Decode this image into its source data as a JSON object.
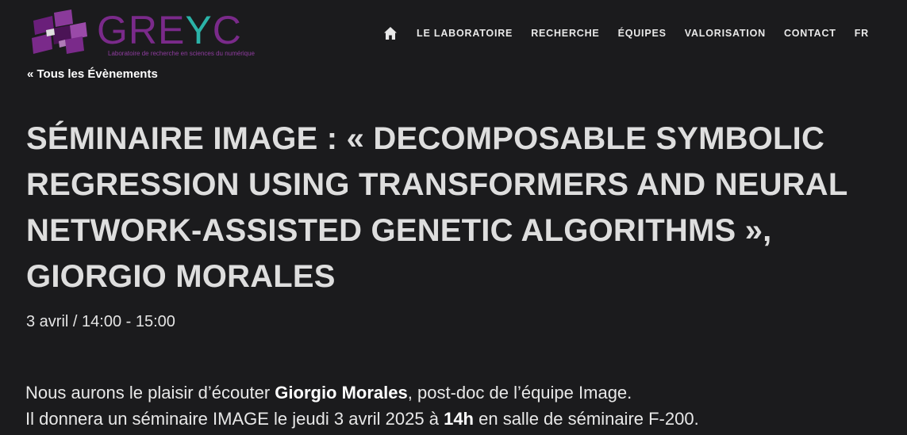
{
  "header": {
    "logo": {
      "word_part1": "GRE",
      "word_y": "Y",
      "word_part2": "C",
      "tagline": "Laboratoire de recherche en sciences du numérique",
      "colors": {
        "purple": "#7a2a8a",
        "teal": "#2bb3a8"
      }
    },
    "nav": {
      "home_icon": "home-icon",
      "items": [
        "LE LABORATOIRE",
        "RECHERCHE",
        "ÉQUIPES",
        "VALORISATION",
        "CONTACT",
        "FR"
      ]
    }
  },
  "main": {
    "back_link": "« Tous les Évènements",
    "title": "SÉMINAIRE IMAGE : « DECOMPOSABLE SYMBOLIC REGRESSION USING TRANSFORMERS AND NEURAL NETWORK-ASSISTED GENETIC ALGORITHMS », GIORGIO MORALES",
    "datetime": "3 avril / 14:00 - 15:00",
    "paragraph1": {
      "before": "Nous aurons le plaisir d’écouter ",
      "name": "Giorgio Morales",
      "after": ", post-doc de l’équipe Image."
    },
    "paragraph2": {
      "before": "Il donnera un séminaire IMAGE le jeudi 3 avril 2025 à ",
      "time": "14h",
      "after": " en salle de séminaire F-200."
    }
  },
  "colors": {
    "background": "#1b1b1d",
    "text": "#dedede"
  }
}
